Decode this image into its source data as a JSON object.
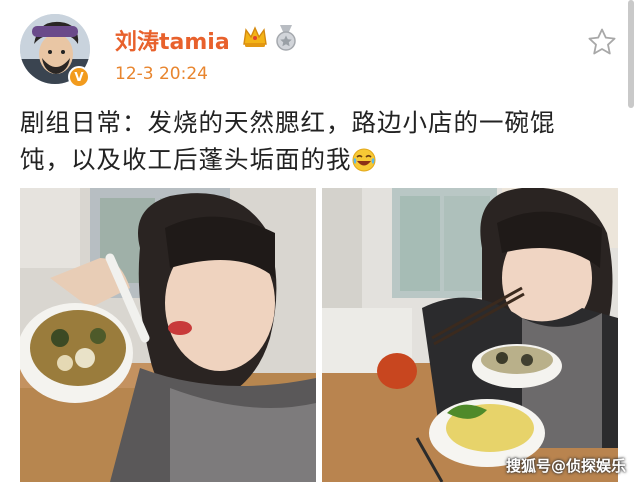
{
  "post": {
    "author": {
      "name": "刘涛tamia"
    },
    "timestamp": "12-3 20:24",
    "text_lines": [
      "剧组日常：发烧的天然腮红，路边小店的一碗馄",
      "饨，以及收工后蓬头垢面的我"
    ],
    "photos": [
      "eating-wonton-photo",
      "chopsticks-photo"
    ]
  },
  "watermark": "搜狐号@侦探娱乐",
  "icons": {
    "crown": "crown-icon",
    "medal": "medal-icon",
    "favorite": "star-icon",
    "verified": "verified-icon",
    "emoji": "laughing-emoji-icon"
  },
  "colors": {
    "username": "#e8612c",
    "timestamp": "#e8852e",
    "text": "#222222",
    "verified_badge": "#f29b1d"
  }
}
